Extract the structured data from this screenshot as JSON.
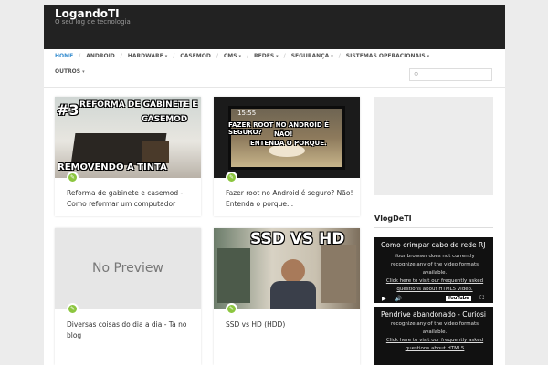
{
  "site": {
    "title": "LogandoTI",
    "description": "O seu log de tecnologia"
  },
  "nav": {
    "items": [
      {
        "label": "HOME",
        "dropdown": false
      },
      {
        "label": "ANDROID",
        "dropdown": false
      },
      {
        "label": "HARDWARE",
        "dropdown": true
      },
      {
        "label": "CASEMOD",
        "dropdown": false
      },
      {
        "label": "CMS",
        "dropdown": true
      },
      {
        "label": "REDES",
        "dropdown": true
      },
      {
        "label": "SEGURANÇA",
        "dropdown": true
      },
      {
        "label": "SISTEMAS OPERACIONAIS",
        "dropdown": true
      },
      {
        "label": "OUTROS",
        "dropdown": true
      }
    ],
    "separator": "/",
    "caret": "▾",
    "active_color": "#3a8fd0"
  },
  "search": {
    "placeholder": "",
    "value": ""
  },
  "posts": [
    {
      "title": "Reforma de gabinete e casemod - Como reformar um computador",
      "thumb": {
        "line1": "#3",
        "line2": "REFORMA DE GABINETE E",
        "line3": "CASEMOD",
        "line4": "REMOVENDO A TINTA"
      }
    },
    {
      "title": "Fazer root no Android é seguro? Não! Entenda o porque...",
      "thumb": {
        "line1": "FAZER ROOT NO ANDROID É SEGURO?",
        "line2": "NÃO!",
        "line3": "ENTENDA O PORQUE.",
        "clock": "15:55"
      }
    },
    {
      "title": "Diversas coisas do dia a dia - Ta no blog",
      "thumb": {
        "line1": "No Preview"
      }
    },
    {
      "title": "SSD vs HD (HDD)",
      "thumb": {
        "line1": "SSD VS HD"
      }
    }
  ],
  "widget": {
    "title": "VlogDeTI",
    "videos": [
      {
        "title": "Como crimpar cabo de rede RJ",
        "msg1": "Your browser does not currently recognize any of the video formats available.",
        "msg2": "Click here to visit our frequently asked questions about HTML5 video."
      },
      {
        "title": "Pendrive abandonado - Curiosi",
        "msg1": "recognize any of the video formats available.",
        "msg2": "Click here to visit our frequently asked questions about HTML5"
      }
    ],
    "youtube_label": "YouTube"
  },
  "colors": {
    "header_bg": "#222222",
    "badge": "#8cc63f",
    "accent": "#3a8fd0"
  },
  "icons": {
    "badge": "pencil-icon",
    "search": "search-icon",
    "play": "play-icon",
    "volume": "volume-icon",
    "fullscreen": "fullscreen-icon"
  }
}
